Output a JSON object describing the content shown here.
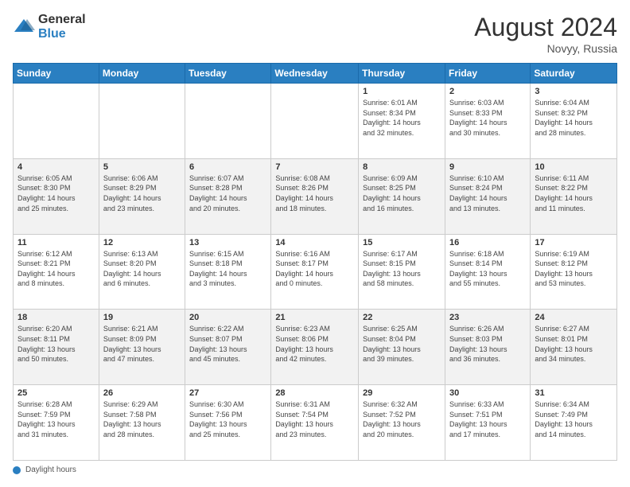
{
  "header": {
    "logo_general": "General",
    "logo_blue": "Blue",
    "month_year": "August 2024",
    "location": "Novyy, Russia"
  },
  "footer": {
    "label": "Daylight hours"
  },
  "days_of_week": [
    "Sunday",
    "Monday",
    "Tuesday",
    "Wednesday",
    "Thursday",
    "Friday",
    "Saturday"
  ],
  "weeks": [
    [
      {
        "day": "",
        "info": ""
      },
      {
        "day": "",
        "info": ""
      },
      {
        "day": "",
        "info": ""
      },
      {
        "day": "",
        "info": ""
      },
      {
        "day": "1",
        "info": "Sunrise: 6:01 AM\nSunset: 8:34 PM\nDaylight: 14 hours\nand 32 minutes."
      },
      {
        "day": "2",
        "info": "Sunrise: 6:03 AM\nSunset: 8:33 PM\nDaylight: 14 hours\nand 30 minutes."
      },
      {
        "day": "3",
        "info": "Sunrise: 6:04 AM\nSunset: 8:32 PM\nDaylight: 14 hours\nand 28 minutes."
      }
    ],
    [
      {
        "day": "4",
        "info": "Sunrise: 6:05 AM\nSunset: 8:30 PM\nDaylight: 14 hours\nand 25 minutes."
      },
      {
        "day": "5",
        "info": "Sunrise: 6:06 AM\nSunset: 8:29 PM\nDaylight: 14 hours\nand 23 minutes."
      },
      {
        "day": "6",
        "info": "Sunrise: 6:07 AM\nSunset: 8:28 PM\nDaylight: 14 hours\nand 20 minutes."
      },
      {
        "day": "7",
        "info": "Sunrise: 6:08 AM\nSunset: 8:26 PM\nDaylight: 14 hours\nand 18 minutes."
      },
      {
        "day": "8",
        "info": "Sunrise: 6:09 AM\nSunset: 8:25 PM\nDaylight: 14 hours\nand 16 minutes."
      },
      {
        "day": "9",
        "info": "Sunrise: 6:10 AM\nSunset: 8:24 PM\nDaylight: 14 hours\nand 13 minutes."
      },
      {
        "day": "10",
        "info": "Sunrise: 6:11 AM\nSunset: 8:22 PM\nDaylight: 14 hours\nand 11 minutes."
      }
    ],
    [
      {
        "day": "11",
        "info": "Sunrise: 6:12 AM\nSunset: 8:21 PM\nDaylight: 14 hours\nand 8 minutes."
      },
      {
        "day": "12",
        "info": "Sunrise: 6:13 AM\nSunset: 8:20 PM\nDaylight: 14 hours\nand 6 minutes."
      },
      {
        "day": "13",
        "info": "Sunrise: 6:15 AM\nSunset: 8:18 PM\nDaylight: 14 hours\nand 3 minutes."
      },
      {
        "day": "14",
        "info": "Sunrise: 6:16 AM\nSunset: 8:17 PM\nDaylight: 14 hours\nand 0 minutes."
      },
      {
        "day": "15",
        "info": "Sunrise: 6:17 AM\nSunset: 8:15 PM\nDaylight: 13 hours\nand 58 minutes."
      },
      {
        "day": "16",
        "info": "Sunrise: 6:18 AM\nSunset: 8:14 PM\nDaylight: 13 hours\nand 55 minutes."
      },
      {
        "day": "17",
        "info": "Sunrise: 6:19 AM\nSunset: 8:12 PM\nDaylight: 13 hours\nand 53 minutes."
      }
    ],
    [
      {
        "day": "18",
        "info": "Sunrise: 6:20 AM\nSunset: 8:11 PM\nDaylight: 13 hours\nand 50 minutes."
      },
      {
        "day": "19",
        "info": "Sunrise: 6:21 AM\nSunset: 8:09 PM\nDaylight: 13 hours\nand 47 minutes."
      },
      {
        "day": "20",
        "info": "Sunrise: 6:22 AM\nSunset: 8:07 PM\nDaylight: 13 hours\nand 45 minutes."
      },
      {
        "day": "21",
        "info": "Sunrise: 6:23 AM\nSunset: 8:06 PM\nDaylight: 13 hours\nand 42 minutes."
      },
      {
        "day": "22",
        "info": "Sunrise: 6:25 AM\nSunset: 8:04 PM\nDaylight: 13 hours\nand 39 minutes."
      },
      {
        "day": "23",
        "info": "Sunrise: 6:26 AM\nSunset: 8:03 PM\nDaylight: 13 hours\nand 36 minutes."
      },
      {
        "day": "24",
        "info": "Sunrise: 6:27 AM\nSunset: 8:01 PM\nDaylight: 13 hours\nand 34 minutes."
      }
    ],
    [
      {
        "day": "25",
        "info": "Sunrise: 6:28 AM\nSunset: 7:59 PM\nDaylight: 13 hours\nand 31 minutes."
      },
      {
        "day": "26",
        "info": "Sunrise: 6:29 AM\nSunset: 7:58 PM\nDaylight: 13 hours\nand 28 minutes."
      },
      {
        "day": "27",
        "info": "Sunrise: 6:30 AM\nSunset: 7:56 PM\nDaylight: 13 hours\nand 25 minutes."
      },
      {
        "day": "28",
        "info": "Sunrise: 6:31 AM\nSunset: 7:54 PM\nDaylight: 13 hours\nand 23 minutes."
      },
      {
        "day": "29",
        "info": "Sunrise: 6:32 AM\nSunset: 7:52 PM\nDaylight: 13 hours\nand 20 minutes."
      },
      {
        "day": "30",
        "info": "Sunrise: 6:33 AM\nSunset: 7:51 PM\nDaylight: 13 hours\nand 17 minutes."
      },
      {
        "day": "31",
        "info": "Sunrise: 6:34 AM\nSunset: 7:49 PM\nDaylight: 13 hours\nand 14 minutes."
      }
    ]
  ]
}
